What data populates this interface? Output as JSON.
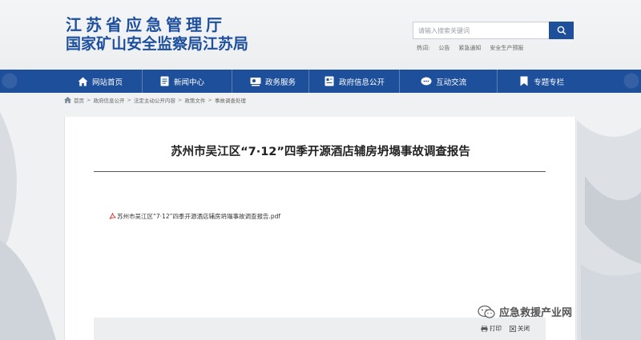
{
  "site": {
    "title_line1": "江苏省应急管理厅",
    "title_line2": "国家矿山安全监察局江苏局"
  },
  "search": {
    "placeholder": "请输入搜索关键词",
    "hot_label": "热词:",
    "hot_words": [
      "公告",
      "紧急通知",
      "安全生产预报"
    ]
  },
  "nav": {
    "items": [
      {
        "label": "网站首页",
        "icon": "home-icon"
      },
      {
        "label": "新闻中心",
        "icon": "document-icon"
      },
      {
        "label": "政务服务",
        "icon": "service-icon"
      },
      {
        "label": "政府信息公开",
        "icon": "open-info-icon"
      },
      {
        "label": "互动交流",
        "icon": "chat-icon"
      },
      {
        "label": "专题专栏",
        "icon": "bookmark-icon"
      }
    ]
  },
  "breadcrumb": {
    "items": [
      "首页",
      "政府信息公开",
      "法定主动公开内容",
      "政策文件",
      "事故调查处理"
    ]
  },
  "article": {
    "title": "苏州市吴江区“7·12”四季开源酒店辅房坍塌事故调查报告",
    "attachment": "苏州市吴江区“7·12”四季开源酒店辅房坍塌事故调查报告.pdf"
  },
  "footer": {
    "print_label": "打印",
    "close_label": "关闭"
  },
  "watermark": {
    "text": "应急救援产业网"
  },
  "colors": {
    "brand_blue": "#1e4f9a",
    "title_blue": "#1d4f9e"
  }
}
